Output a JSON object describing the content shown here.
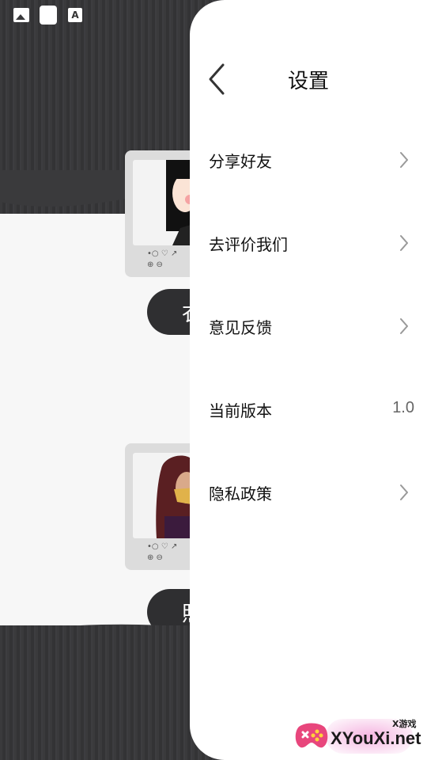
{
  "settings": {
    "title": "设置",
    "items": [
      {
        "label": "分享好友",
        "chevron": true
      },
      {
        "label": "去评价我们",
        "chevron": true
      },
      {
        "label": "意见反馈",
        "chevron": true
      },
      {
        "label": "当前版本",
        "value": "1.0",
        "chevron": false
      },
      {
        "label": "隐私政策",
        "chevron": true
      }
    ]
  },
  "background": {
    "button_1_partial": "衣",
    "button_2_partial": "照"
  },
  "watermark": {
    "small": "X游戏",
    "large": "XYouXi.net"
  },
  "colors": {
    "drawer_bg": "#ffffff",
    "backdrop_dark": "#3a3a3c",
    "chevron": "#999999",
    "text": "#111111"
  }
}
